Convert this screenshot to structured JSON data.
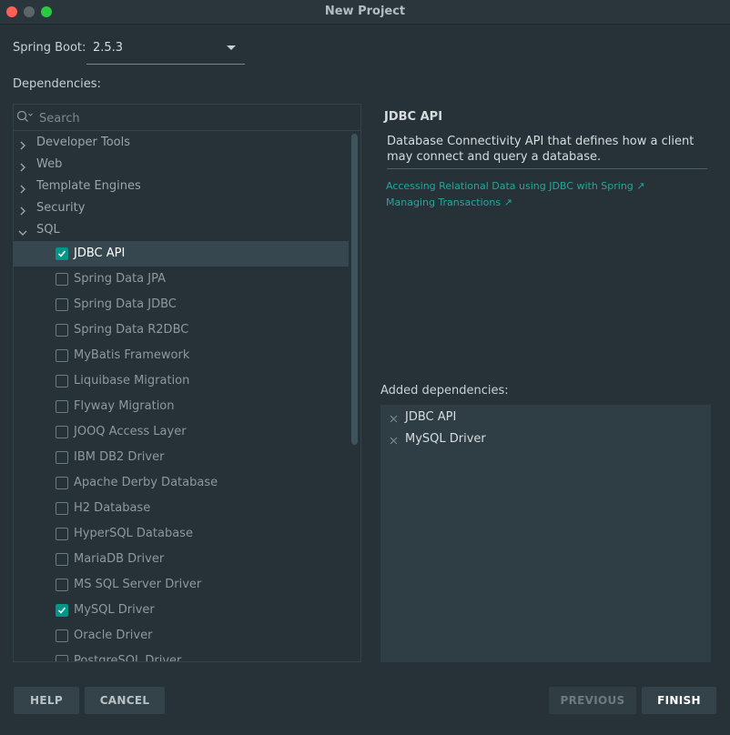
{
  "window": {
    "title": "New Project"
  },
  "spring_boot": {
    "label": "Spring Boot:",
    "value": "2.5.3"
  },
  "dependencies_label": "Dependencies:",
  "search": {
    "placeholder": "Search",
    "icon": "search-icon"
  },
  "tree": {
    "categories": [
      {
        "label": "Developer Tools",
        "expanded": false
      },
      {
        "label": "Web",
        "expanded": false
      },
      {
        "label": "Template Engines",
        "expanded": false
      },
      {
        "label": "Security",
        "expanded": false
      },
      {
        "label": "SQL",
        "expanded": true
      }
    ],
    "sql_items": [
      {
        "label": "JDBC API",
        "checked": true,
        "selected": true
      },
      {
        "label": "Spring Data JPA",
        "checked": false
      },
      {
        "label": "Spring Data JDBC",
        "checked": false
      },
      {
        "label": "Spring Data R2DBC",
        "checked": false
      },
      {
        "label": "MyBatis Framework",
        "checked": false
      },
      {
        "label": "Liquibase Migration",
        "checked": false
      },
      {
        "label": "Flyway Migration",
        "checked": false
      },
      {
        "label": "JOOQ Access Layer",
        "checked": false
      },
      {
        "label": "IBM DB2 Driver",
        "checked": false
      },
      {
        "label": "Apache Derby Database",
        "checked": false
      },
      {
        "label": "H2 Database",
        "checked": false
      },
      {
        "label": "HyperSQL Database",
        "checked": false
      },
      {
        "label": "MariaDB Driver",
        "checked": false
      },
      {
        "label": "MS SQL Server Driver",
        "checked": false
      },
      {
        "label": "MySQL Driver",
        "checked": true
      },
      {
        "label": "Oracle Driver",
        "checked": false
      },
      {
        "label": "PostgreSQL Driver",
        "checked": false
      }
    ]
  },
  "detail": {
    "title": "JDBC API",
    "description": "Database Connectivity API that defines how a client may connect and query a database.",
    "links": [
      "Accessing Relational Data using JDBC with Spring ↗",
      "Managing Transactions ↗"
    ]
  },
  "added": {
    "label": "Added dependencies:",
    "items": [
      "JDBC API",
      "MySQL Driver"
    ]
  },
  "buttons": {
    "help": "HELP",
    "cancel": "CANCEL",
    "previous": "PREVIOUS",
    "finish": "FINISH"
  },
  "colors": {
    "background": "#263238",
    "accent": "#009688",
    "link": "#26a69a",
    "selected_row": "#37474f"
  }
}
